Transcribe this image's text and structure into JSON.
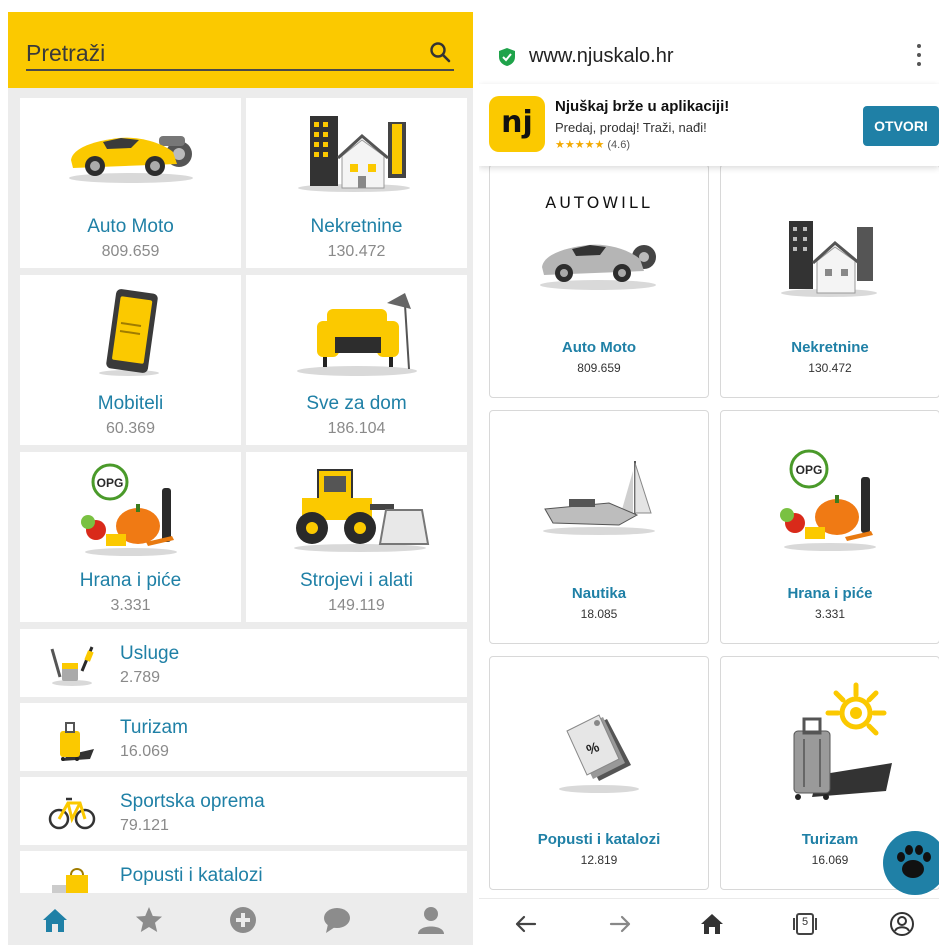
{
  "left_app": {
    "search": {
      "placeholder": "Pretraži",
      "icon": "search-icon"
    },
    "grid_categories": [
      {
        "title": "Auto Moto",
        "count": "809.659",
        "icon": "car-icon"
      },
      {
        "title": "Nekretnine",
        "count": "130.472",
        "icon": "buildings-icon"
      },
      {
        "title": "Mobiteli",
        "count": "60.369",
        "icon": "phone-icon"
      },
      {
        "title": "Sve za dom",
        "count": "186.104",
        "icon": "armchair-icon"
      },
      {
        "title": "Hrana i piće",
        "count": "3.331",
        "icon": "food-icon",
        "badge": "OPG"
      },
      {
        "title": "Strojevi i alati",
        "count": "149.119",
        "icon": "bulldozer-icon"
      }
    ],
    "list_categories": [
      {
        "title": "Usluge",
        "count": "2.789",
        "icon": "tools-icon"
      },
      {
        "title": "Turizam",
        "count": "16.069",
        "icon": "suitcase-icon"
      },
      {
        "title": "Sportska oprema",
        "count": "79.121",
        "icon": "bicycle-icon"
      },
      {
        "title": "Popusti i katalozi",
        "count": "",
        "icon": "shopping-bag-icon"
      }
    ],
    "bottom_nav": [
      {
        "name": "home",
        "icon": "home-icon",
        "active": true
      },
      {
        "name": "favorites",
        "icon": "star-icon",
        "active": false
      },
      {
        "name": "add",
        "icon": "plus-circle-icon",
        "active": false
      },
      {
        "name": "messages",
        "icon": "chat-icon",
        "active": false
      },
      {
        "name": "profile",
        "icon": "user-icon",
        "active": false
      }
    ]
  },
  "browser": {
    "url": "www.njuskalo.hr",
    "banner": {
      "logo_text": "nj",
      "title": "Njuškaj brže u aplikaciji!",
      "subtitle": "Predaj, prodaj! Traži, nađi!",
      "stars": "★★★★★",
      "rating": "(4.6)",
      "button": "OTVORI"
    },
    "sponsor_logo": "AUTOWILL",
    "tiles": [
      {
        "title": "Auto Moto",
        "count": "809.659",
        "icon": "car-icon"
      },
      {
        "title": "Nekretnine",
        "count": "130.472",
        "icon": "buildings-icon"
      },
      {
        "title": "Nautika",
        "count": "18.085",
        "icon": "boat-icon"
      },
      {
        "title": "Hrana i piće",
        "count": "3.331",
        "icon": "food-icon",
        "badge": "OPG"
      },
      {
        "title": "Popusti i katalozi",
        "count": "12.819",
        "icon": "discount-tag-icon",
        "tag_text": "%"
      },
      {
        "title": "Turizam",
        "count": "16.069",
        "icon": "suitcase-sun-icon"
      }
    ],
    "tab_count": "5",
    "nav": [
      "back-icon",
      "forward-icon",
      "home-icon",
      "tabs-icon",
      "account-icon"
    ]
  },
  "colors": {
    "brand_yellow": "#fbc900",
    "brand_blue": "#1f80a6",
    "count_gray": "#8a8a8a",
    "background_gray": "#ececec"
  }
}
